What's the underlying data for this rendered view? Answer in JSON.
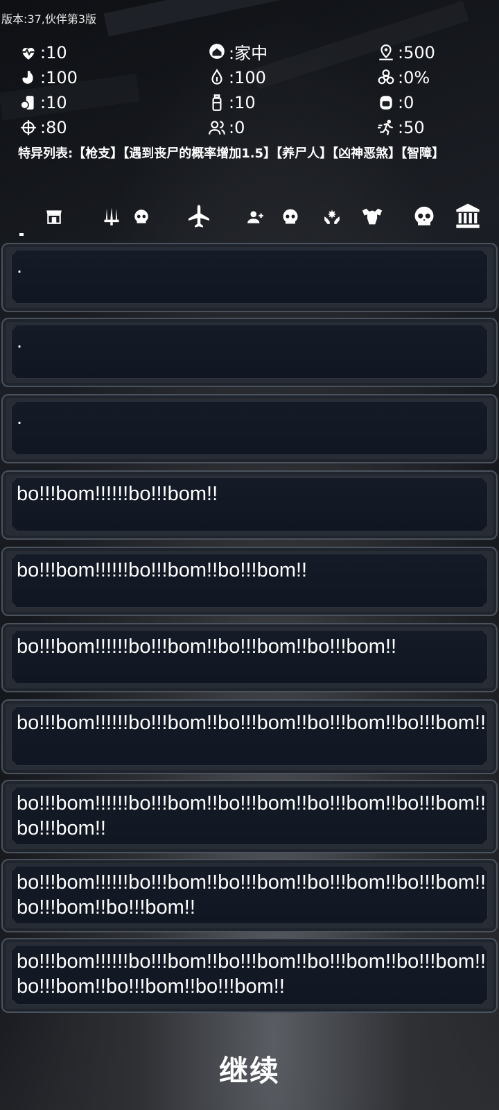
{
  "version": "版本:37,伙伴第3版",
  "stats": [
    {
      "icon": "heartbeat-icon",
      "value": ":10"
    },
    {
      "icon": "home-location-icon",
      "value": ":家中"
    },
    {
      "icon": "map-pin-icon",
      "value": ":500"
    },
    {
      "icon": "stomach-icon",
      "value": ":100"
    },
    {
      "icon": "water-drop-icon",
      "value": ":100"
    },
    {
      "icon": "biohazard-icon",
      "value": ":0%"
    },
    {
      "icon": "food-can-icon",
      "value": ":10"
    },
    {
      "icon": "water-bottle-icon",
      "value": ":10"
    },
    {
      "icon": "bandage-icon",
      "value": ":0"
    },
    {
      "icon": "crosshair-icon",
      "value": ":80"
    },
    {
      "icon": "companions-icon",
      "value": ":0"
    },
    {
      "icon": "running-icon",
      "value": ":50"
    }
  ],
  "traits": "特异列表:【枪支】【遇到丧尸的概率增加1.5】【养尸人】【凶神恶煞】【智障】",
  "nav": [
    "shop-icon",
    "weapons-icon",
    "skull-icon",
    "airplane-icon",
    "add-person-icon",
    "skull-icon",
    "healing-hands-icon",
    "muscle-icon",
    "skull-large-icon",
    "bank-icon"
  ],
  "log": [
    ".",
    ".",
    ".",
    "bo!!!bom!!!!!!bo!!!bom!!",
    "bo!!!bom!!!!!!bo!!!bom!!bo!!!bom!!",
    "bo!!!bom!!!!!!bo!!!bom!!bo!!!bom!!bo!!!bom!!",
    "bo!!!bom!!!!!!bo!!!bom!!bo!!!bom!!bo!!!bom!!bo!!!bom!!",
    "bo!!!bom!!!!!!bo!!!bom!!bo!!!bom!!bo!!!bom!!bo!!!bom!!bo!!!bom!!",
    "bo!!!bom!!!!!!bo!!!bom!!bo!!!bom!!bo!!!bom!!bo!!!bom!!bo!!!bom!!bo!!!bom!!",
    "bo!!!bom!!!!!!bo!!!bom!!bo!!!bom!!bo!!!bom!!bo!!!bom!!bo!!!bom!!bo!!!bom!!bo!!!bom!!"
  ],
  "continue_label": "继续"
}
